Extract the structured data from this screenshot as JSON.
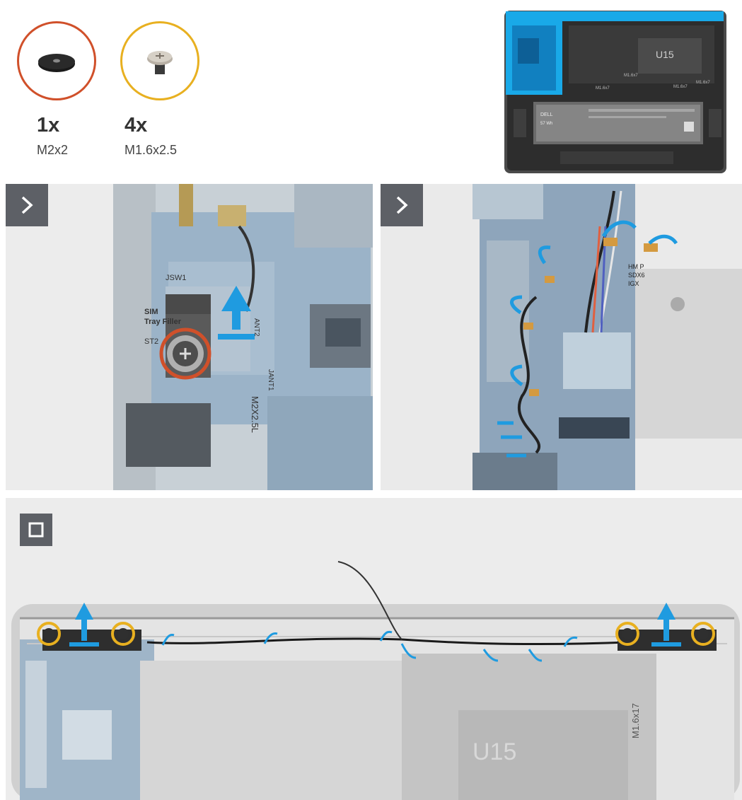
{
  "screws": [
    {
      "qty": "1x",
      "size": "M2x2",
      "ring_color": "#d0502a",
      "icon": "flat-head-screw-icon"
    },
    {
      "qty": "4x",
      "size": "M1.6x2.5",
      "ring_color": "#e8b020",
      "icon": "pan-head-screw-icon"
    }
  ],
  "overview": {
    "labels": [
      "U15",
      "M1.6x7",
      "M1.6x7",
      "M1.6x7",
      "M1.6x7",
      "DELL",
      "57 Wh"
    ],
    "highlight_color": "#19a9e8"
  },
  "panels": [
    {
      "step_icon": "chevron-right-icon",
      "labels": [
        "JSW1",
        "SIM",
        "Tray Filler",
        "ST2",
        "ANT2",
        "JANT1",
        "M2X2.5L"
      ]
    },
    {
      "step_icon": "chevron-right-icon",
      "labels": [
        "HM P",
        "SDX6",
        "IGX"
      ]
    },
    {
      "step_icon": "stop-square-icon",
      "labels": [
        "U15",
        "M1.6x17"
      ]
    }
  ],
  "colors": {
    "accent": "#1f9be0",
    "screw_orange": "#d0502a",
    "screw_yellow": "#e8b020",
    "step_icon_bg": "#5d6066"
  }
}
